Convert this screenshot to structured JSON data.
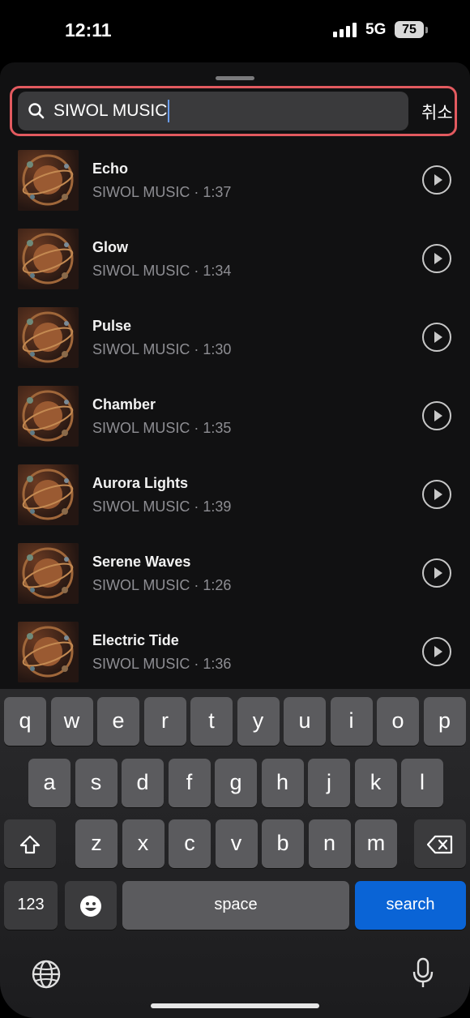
{
  "status_bar": {
    "time": "12:11",
    "network": "5G",
    "battery": "75"
  },
  "search": {
    "query": "SIWOL MUSIC",
    "cancel_label": "취소"
  },
  "tracks": [
    {
      "title": "Echo",
      "subtitle": "SIWOL MUSIC · 1:37"
    },
    {
      "title": "Glow",
      "subtitle": "SIWOL MUSIC · 1:34"
    },
    {
      "title": "Pulse",
      "subtitle": "SIWOL MUSIC · 1:30"
    },
    {
      "title": "Chamber",
      "subtitle": "SIWOL MUSIC · 1:35"
    },
    {
      "title": "Aurora Lights",
      "subtitle": "SIWOL MUSIC · 1:39"
    },
    {
      "title": "Serene Waves",
      "subtitle": "SIWOL MUSIC · 1:26"
    },
    {
      "title": "Electric Tide",
      "subtitle": "SIWOL MUSIC · 1:36"
    }
  ],
  "keyboard": {
    "row1": [
      "q",
      "w",
      "e",
      "r",
      "t",
      "y",
      "u",
      "i",
      "o",
      "p"
    ],
    "row2": [
      "a",
      "s",
      "d",
      "f",
      "g",
      "h",
      "j",
      "k",
      "l"
    ],
    "row3": [
      "z",
      "x",
      "c",
      "v",
      "b",
      "n",
      "m"
    ],
    "numbers_label": "123",
    "space_label": "space",
    "search_label": "search"
  },
  "colors": {
    "highlight": "#e25a5f",
    "search_key": "#0a64d6"
  }
}
